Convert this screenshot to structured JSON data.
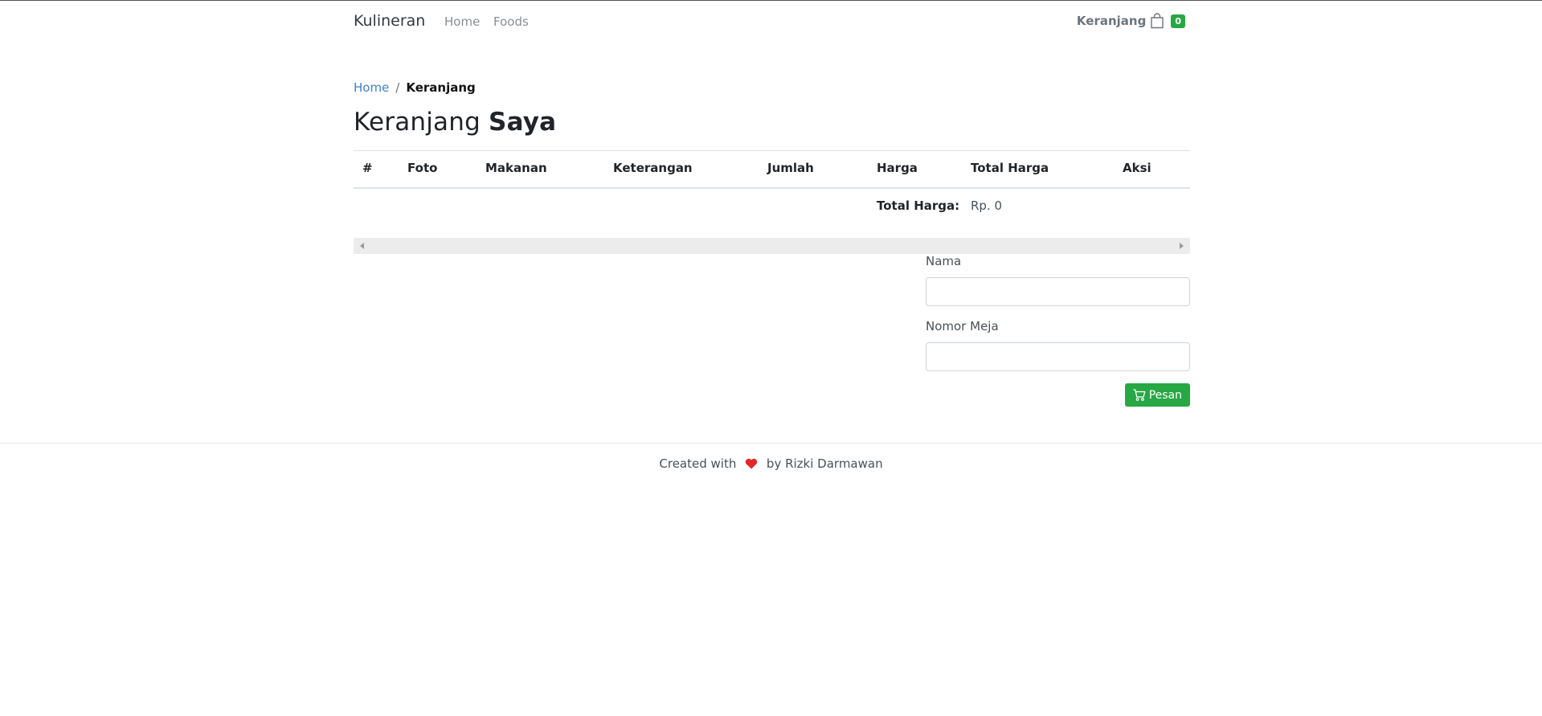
{
  "navbar": {
    "brand": "Kulineran",
    "links": [
      "Home",
      "Foods"
    ],
    "cart_label": "Keranjang",
    "cart_count": "0"
  },
  "breadcrumb": {
    "home": "Home",
    "separator": "/",
    "current": "Keranjang"
  },
  "page_title": {
    "light": "Keranjang",
    "bold": "Saya"
  },
  "table": {
    "headers": [
      "#",
      "Foto",
      "Makanan",
      "Keterangan",
      "Jumlah",
      "Harga",
      "Total Harga",
      "Aksi"
    ],
    "rows": [],
    "total_label": "Total Harga:",
    "total_value": "Rp. 0"
  },
  "form": {
    "name_label": "Nama",
    "name_value": "",
    "table_label": "Nomor Meja",
    "table_value": "",
    "submit_label": "Pesan"
  },
  "footer": {
    "text_before": "Created with",
    "text_after": "by Rizki Darmawan"
  },
  "colors": {
    "accent_green": "#28a745",
    "link_blue": "#3b82d6",
    "heart_red": "#e3262a"
  },
  "icons": {
    "cart": "shopping-bag-icon",
    "submit": "cart-icon",
    "heart": "heart-icon"
  }
}
